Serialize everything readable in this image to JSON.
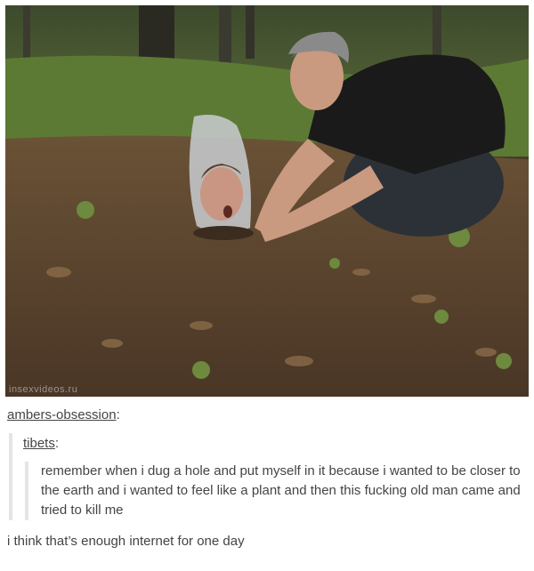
{
  "photo": {
    "alt": "man kneeling next to a person's head wrapped in a plastic bag sticking out of the dirt",
    "watermark": "insexvideos.ru"
  },
  "post": {
    "username": "ambers-obsession",
    "username_suffix": ":",
    "quote": {
      "username": "tibets",
      "username_suffix": ":",
      "text": "remember when i dug a hole and put myself in it because i wanted to be closer to the earth and i wanted to feel like a plant and then this fucking old man came and tried to kill me"
    },
    "reply": "i think that’s enough internet for one day"
  }
}
